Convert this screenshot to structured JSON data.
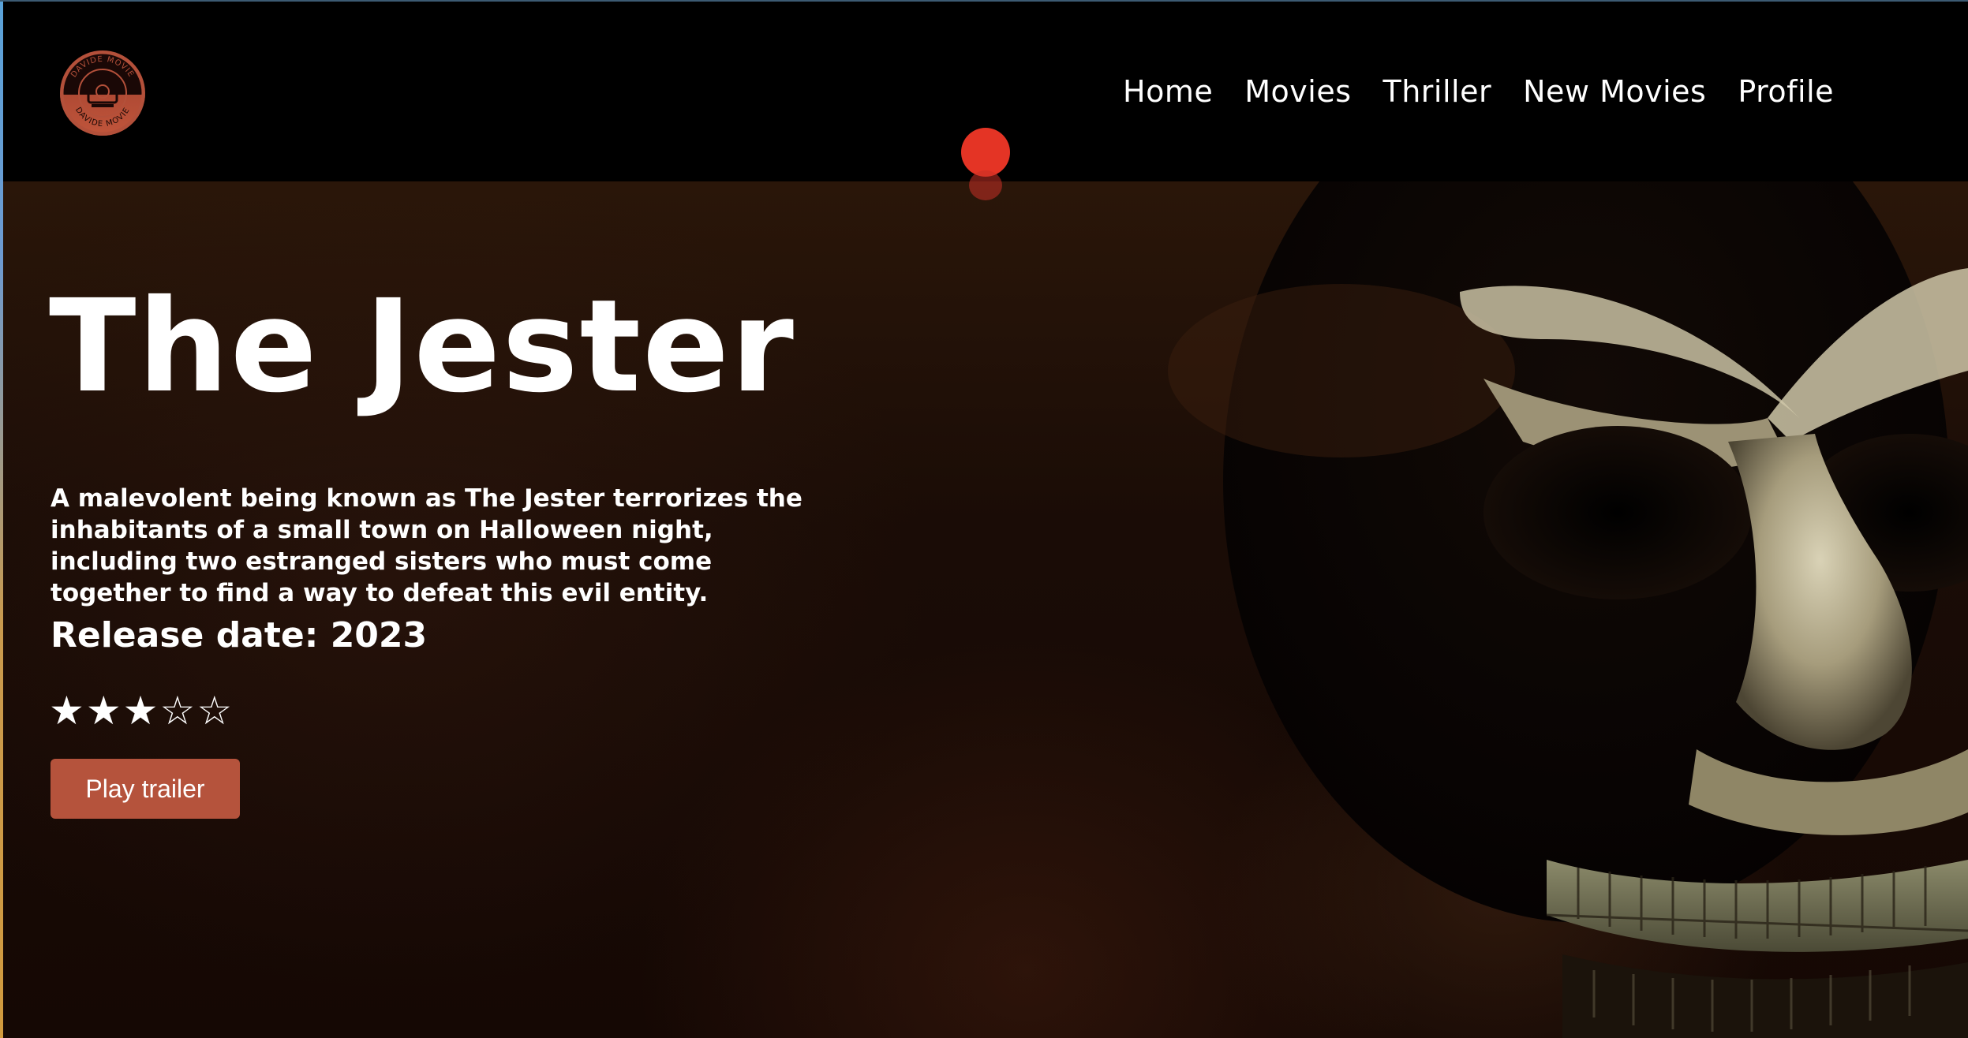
{
  "nav": {
    "logo_text_top": "DAVIDE MOVIE",
    "logo_text_bottom": "DAVIDE MOVIE",
    "items": [
      {
        "label": "Home"
      },
      {
        "label": "Movies"
      },
      {
        "label": "Thriller"
      },
      {
        "label": "New Movies"
      },
      {
        "label": "Profile"
      }
    ]
  },
  "hero": {
    "title": "The Jester",
    "description": "A malevolent being known as The Jester terrorizes the inhabitants of a small town on Halloween night, including two estranged sisters who must come together to find a way to defeat this evil entity.",
    "release_label": "Release date:",
    "release_year": "2023",
    "rating": {
      "value": 3,
      "max": 5,
      "filled_glyph": "★",
      "empty_glyph": "☆"
    },
    "play_button": "Play trailer"
  },
  "colors": {
    "accent": "#b5533c",
    "cursor": "#e43425",
    "navbar": "#000000"
  }
}
